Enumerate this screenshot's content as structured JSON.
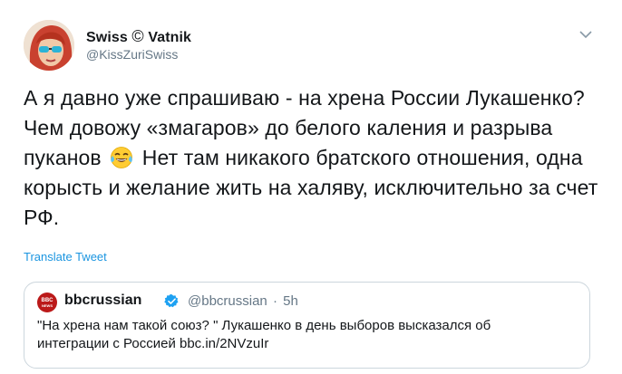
{
  "author": {
    "name": "Swiss",
    "name_symbol": "©",
    "name_suffix": "Vatnik",
    "handle": "@KissZuriSwiss"
  },
  "tweet": {
    "text_before_emoji": "А я давно уже спрашиваю - на хрена России Лукашенко? Чем довожу «змагаров» до белого каления и разрыва пуканов",
    "emoji": "tears-of-joy-emoji",
    "text_after_emoji": "Нет там никакого братского отношения, одна корысть и желание жить на халяву, исключительно за счет РФ."
  },
  "translate_label": "Translate Tweet",
  "quoted": {
    "name": "bbcrussian",
    "handle": "@bbcrussian",
    "separator": "·",
    "time": "5h",
    "logo_text_top": "BBC",
    "logo_text_bottom": "NEWS",
    "text_line1": "\"На хрена нам такой союз? \" Лукашенко в день выборов высказался об",
    "text_line2": "интеграции с Россией bbc.in/2NVzuIr"
  },
  "icons": {
    "caret": "chevron-down-icon",
    "verified": "verified-badge-icon"
  },
  "colors": {
    "link": "#1b95e0",
    "secondary_text": "#657786",
    "border": "#ccd6dd",
    "verified": "#1da1f2",
    "bbc_red": "#bb1919"
  }
}
